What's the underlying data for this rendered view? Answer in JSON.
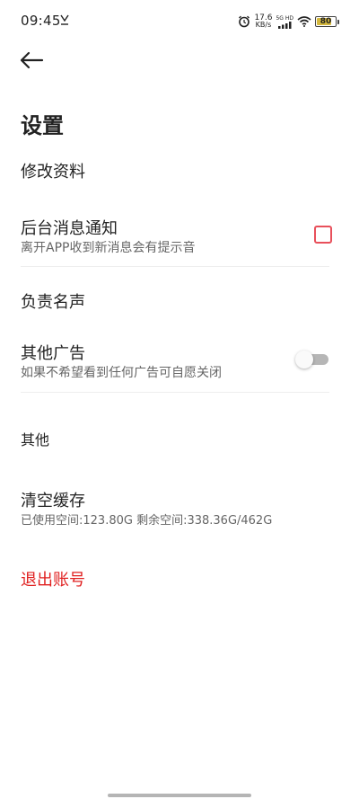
{
  "status_bar": {
    "time": "09:45",
    "net_speed_value": "17.6",
    "net_speed_unit": "KB/s",
    "signal_label": "5G HD",
    "battery_level": "80"
  },
  "header": {
    "back_icon": "arrow-left-icon",
    "title": "设置"
  },
  "settings": {
    "edit_profile": {
      "title": "修改资料"
    },
    "notifications": {
      "title": "后台消息通知",
      "subtitle": "离开APP收到新消息会有提示音",
      "checked": false
    },
    "disclaimer": {
      "title": "负责名声"
    },
    "ads": {
      "title": "其他广告",
      "subtitle": "如果不希望看到任何广告可自愿关闭",
      "enabled": false
    },
    "other_section": "其他",
    "cache": {
      "title": "清空缓存",
      "subtitle": "已使用空间:123.80G 剩余空间:338.36G/462G"
    },
    "logout": "退出账号"
  },
  "colors": {
    "accent_red": "#e02020",
    "checkbox_border": "#e8505b",
    "battery": "#d4b83c"
  }
}
